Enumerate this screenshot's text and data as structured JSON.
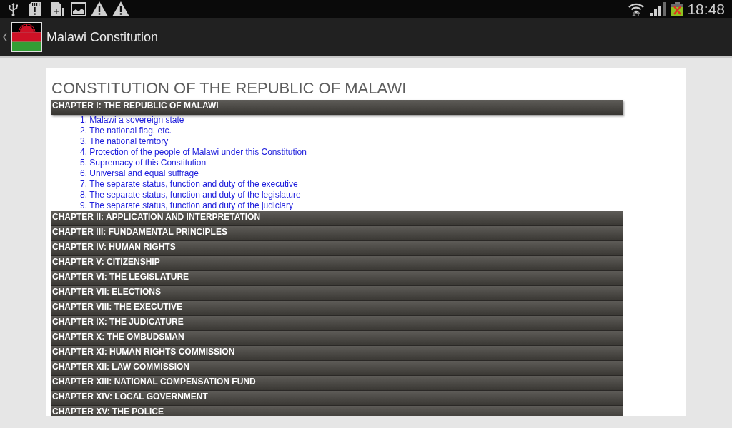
{
  "status_bar": {
    "time": "18:48"
  },
  "action_bar": {
    "title": "Malawi Constitution"
  },
  "document": {
    "title": "CONSTITUTION OF THE REPUBLIC OF MALAWI",
    "chapters": [
      {
        "title": "CHAPTER I: THE REPUBLIC OF MALAWI",
        "expanded": true,
        "sections": [
          "1. Malawi a sovereign state",
          "2. The national flag, etc.",
          "3. The national territory",
          "4. Protection of the people of Malawi under this Constitution",
          "5. Supremacy of this Constitution",
          "6. Universal and equal suffrage",
          "7. The separate status, function and duty of the executive",
          "8. The separate status, function and duty of the legislature",
          "9. The separate status, function and duty of the judiciary"
        ]
      },
      {
        "title": "CHAPTER II: APPLICATION AND INTERPRETATION",
        "expanded": false
      },
      {
        "title": "CHAPTER III: FUNDAMENTAL PRINCIPLES",
        "expanded": false
      },
      {
        "title": "CHAPTER IV: HUMAN RIGHTS",
        "expanded": false
      },
      {
        "title": "CHAPTER V: CITIZENSHIP",
        "expanded": false
      },
      {
        "title": "CHAPTER VI: THE LEGISLATURE",
        "expanded": false
      },
      {
        "title": "CHAPTER VII: ELECTIONS",
        "expanded": false
      },
      {
        "title": "CHAPTER VIII: THE EXECUTIVE",
        "expanded": false
      },
      {
        "title": "CHAPTER IX: THE JUDICATURE",
        "expanded": false
      },
      {
        "title": "CHAPTER X: THE OMBUDSMAN",
        "expanded": false
      },
      {
        "title": "CHAPTER XI: HUMAN RIGHTS COMMISSION",
        "expanded": false
      },
      {
        "title": "CHAPTER XII: LAW COMMISSION",
        "expanded": false
      },
      {
        "title": "CHAPTER XIII: NATIONAL COMPENSATION FUND",
        "expanded": false
      },
      {
        "title": "CHAPTER XIV: LOCAL GOVERNMENT",
        "expanded": false
      },
      {
        "title": "CHAPTER XV: THE POLICE",
        "expanded": false
      }
    ]
  }
}
